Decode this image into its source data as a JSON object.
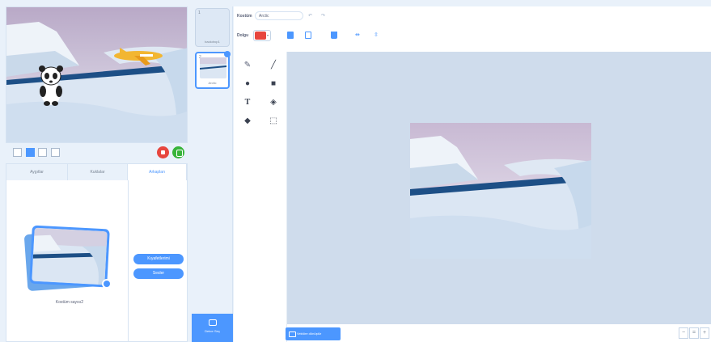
{
  "left_tabs": [
    "Aygıtlar",
    "Kuklalar",
    "Arkaplan"
  ],
  "backdrop": {
    "label": "Kostüm sayısı2"
  },
  "backdrop_actions": [
    "Kıyafetlerimi",
    "Sesler"
  ],
  "costumes": [
    {
      "number": "1",
      "name": "backdrop1"
    },
    {
      "number": "2",
      "name": "Arctic"
    }
  ],
  "choose_backdrop": "Dekor Seç",
  "editor": {
    "name_label": "Kostüm",
    "name_value": "Arctic",
    "fill_label": "Dolgu",
    "fill_color": "#e7463e",
    "convert_button": "Vektöre dönüştür",
    "zoom_out": "−",
    "zoom_reset": "=",
    "zoom_in": "+"
  },
  "colors": {
    "accent": "#4c97ff",
    "stop": "#e7463e",
    "go": "#38b43a"
  },
  "icons": [
    "undo-icon",
    "redo-icon",
    "copy-icon",
    "paste-icon",
    "trash-icon",
    "flip-horizontal-icon",
    "flip-vertical-icon",
    "brush-icon",
    "line-icon",
    "circle-icon",
    "rectangle-icon",
    "text-icon",
    "fill-icon",
    "eraser-icon",
    "select-icon",
    "zoom-in-icon",
    "zoom-reset-icon",
    "zoom-out-icon",
    "green-flag-icon",
    "stop-icon"
  ]
}
